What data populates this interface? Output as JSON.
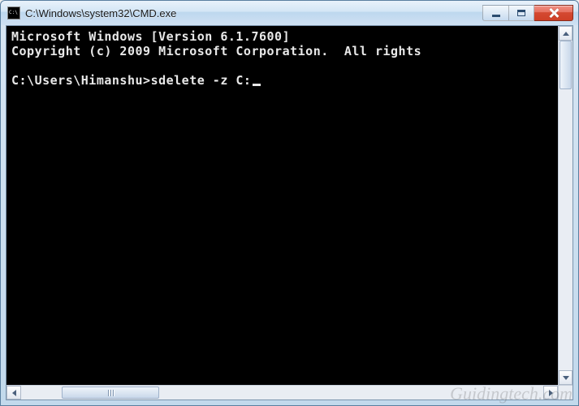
{
  "window": {
    "title": "C:\\Windows\\system32\\CMD.exe",
    "icon_label": "C:\\"
  },
  "console": {
    "line1": "Microsoft Windows [Version 6.1.7600]",
    "line2": "Copyright (c) 2009 Microsoft Corporation.  All rights",
    "blank": "",
    "prompt": "C:\\Users\\Himanshu>",
    "command": "sdelete -z C:"
  },
  "watermark": "Guidingtech.com"
}
